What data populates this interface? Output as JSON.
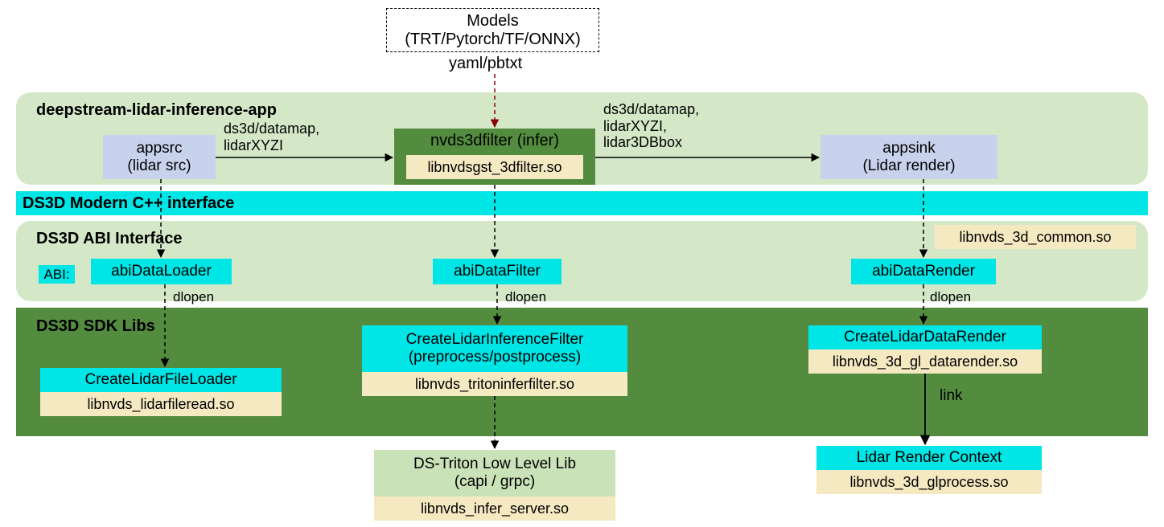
{
  "chart_data": {
    "type": "diagram",
    "title": "deepstream-lidar-inference-app architecture",
    "layers": [
      {
        "name": "App layer",
        "label": "deepstream-lidar-inference-app"
      },
      {
        "name": "Modern C++ layer",
        "label": "DS3D Modern C++ interface"
      },
      {
        "name": "ABI layer",
        "label": "DS3D ABI  Interface"
      },
      {
        "name": "SDK layer",
        "label": "DS3D SDK Libs"
      }
    ],
    "columns": [
      "loader",
      "filter",
      "render"
    ],
    "nodes": [
      {
        "id": "models",
        "label": "Models\n(TRT/Pytorch/TF/ONNX)"
      },
      {
        "id": "appsrc",
        "label": "appsrc\n(lidar src)",
        "column": "loader",
        "layer": "App layer"
      },
      {
        "id": "nvds3d",
        "label": "nvds3dfilter (infer)",
        "column": "filter",
        "layer": "App layer",
        "lib": "libnvdsgst_3dfilter.so"
      },
      {
        "id": "appsink",
        "label": "appsink\n(Lidar render)",
        "column": "render",
        "layer": "App layer"
      },
      {
        "id": "abiLoader",
        "label": "abiDataLoader",
        "column": "loader",
        "layer": "ABI layer"
      },
      {
        "id": "abiFilter",
        "label": "abiDataFilter",
        "column": "filter",
        "layer": "ABI layer"
      },
      {
        "id": "abiRender",
        "label": "abiDataRender",
        "column": "render",
        "layer": "ABI layer"
      },
      {
        "id": "fileLoader",
        "label": "CreateLidarFileLoader",
        "column": "loader",
        "layer": "SDK layer",
        "lib": "libnvds_lidarfileread.so"
      },
      {
        "id": "inferFilter",
        "label": "CreateLidarInferenceFilter\n(preprocess/postprocess)",
        "column": "filter",
        "layer": "SDK layer",
        "lib": "libnvds_tritoninferfilter.so"
      },
      {
        "id": "dataRender",
        "label": "CreateLidarDataRender",
        "column": "render",
        "layer": "SDK layer",
        "lib": "libnvds_3d_gl_datarender.so"
      },
      {
        "id": "common",
        "label": "libnvds_3d_common.so",
        "column": "render",
        "layer": "ABI layer"
      },
      {
        "id": "triton",
        "label": "DS-Triton Low Level Lib\n(capi / grpc)",
        "column": "filter",
        "lib": "libnvds_infer_server.so"
      },
      {
        "id": "glctx",
        "label": "Lidar Render Context",
        "column": "render",
        "lib": "libnvds_3d_glprocess.so"
      }
    ],
    "edges": [
      {
        "from": "models",
        "to": "nvds3d",
        "label": "yaml/pbtxt",
        "style": "dashed"
      },
      {
        "from": "appsrc",
        "to": "nvds3d",
        "label": "ds3d/datamap,\nlidarXYZI",
        "style": "solid"
      },
      {
        "from": "nvds3d",
        "to": "appsink",
        "label": "ds3d/datamap,\nlidarXYZI,\nlidar3DBbox",
        "style": "solid"
      },
      {
        "from": "appsrc",
        "to": "abiLoader",
        "style": "dashed"
      },
      {
        "from": "nvds3d",
        "to": "abiFilter",
        "style": "dashed"
      },
      {
        "from": "appsink",
        "to": "abiRender",
        "style": "dashed"
      },
      {
        "from": "abiLoader",
        "to": "fileLoader",
        "label": "dlopen",
        "style": "dashed"
      },
      {
        "from": "abiFilter",
        "to": "inferFilter",
        "label": "dlopen",
        "style": "dashed"
      },
      {
        "from": "abiRender",
        "to": "dataRender",
        "label": "dlopen",
        "style": "dashed"
      },
      {
        "from": "inferFilter",
        "to": "triton",
        "style": "dashed"
      },
      {
        "from": "dataRender",
        "to": "glctx",
        "label": "link",
        "style": "solid"
      }
    ]
  },
  "models": {
    "line1": "Models",
    "line2": "(TRT/Pytorch/TF/ONNX)"
  },
  "yaml_label": "yaml/pbtxt",
  "app": {
    "header": "deepstream-lidar-inference-app",
    "appsrc": {
      "line1": "appsrc",
      "line2": "(lidar src)"
    },
    "edge1": {
      "line1": "ds3d/datamap,",
      "line2": "lidarXYZI"
    },
    "nvds3d": {
      "title": "nvds3dfilter (infer)",
      "lib": "libnvdsgst_3dfilter.so"
    },
    "edge2": {
      "line1": "ds3d/datamap,",
      "line2": "lidarXYZI,",
      "line3": "lidar3DBbox"
    },
    "appsink": {
      "line1": "appsink",
      "line2": "(Lidar render)"
    }
  },
  "cpp_band": "DS3D Modern C++ interface",
  "abi": {
    "header": "DS3D ABI  Interface",
    "tag": "ABI:",
    "loader": "abiDataLoader",
    "filter": "abiDataFilter",
    "render": "abiDataRender",
    "common_lib": "libnvds_3d_common.so"
  },
  "dlopen": "dlopen",
  "sdk": {
    "header": "DS3D SDK Libs",
    "loader": {
      "title": "CreateLidarFileLoader",
      "lib": "libnvds_lidarfileread.so"
    },
    "filter": {
      "line1": "CreateLidarInferenceFilter",
      "line2": "(preprocess/postprocess)",
      "lib": "libnvds_tritoninferfilter.so"
    },
    "render": {
      "title": "CreateLidarDataRender",
      "lib": "libnvds_3d_gl_datarender.so"
    }
  },
  "link_label": "link",
  "triton": {
    "line1": "DS-Triton Low Level Lib",
    "line2": "(capi / grpc)",
    "lib": "libnvds_infer_server.so"
  },
  "glctx": {
    "title": "Lidar Render Context",
    "lib": "libnvds_3d_glprocess.so"
  }
}
